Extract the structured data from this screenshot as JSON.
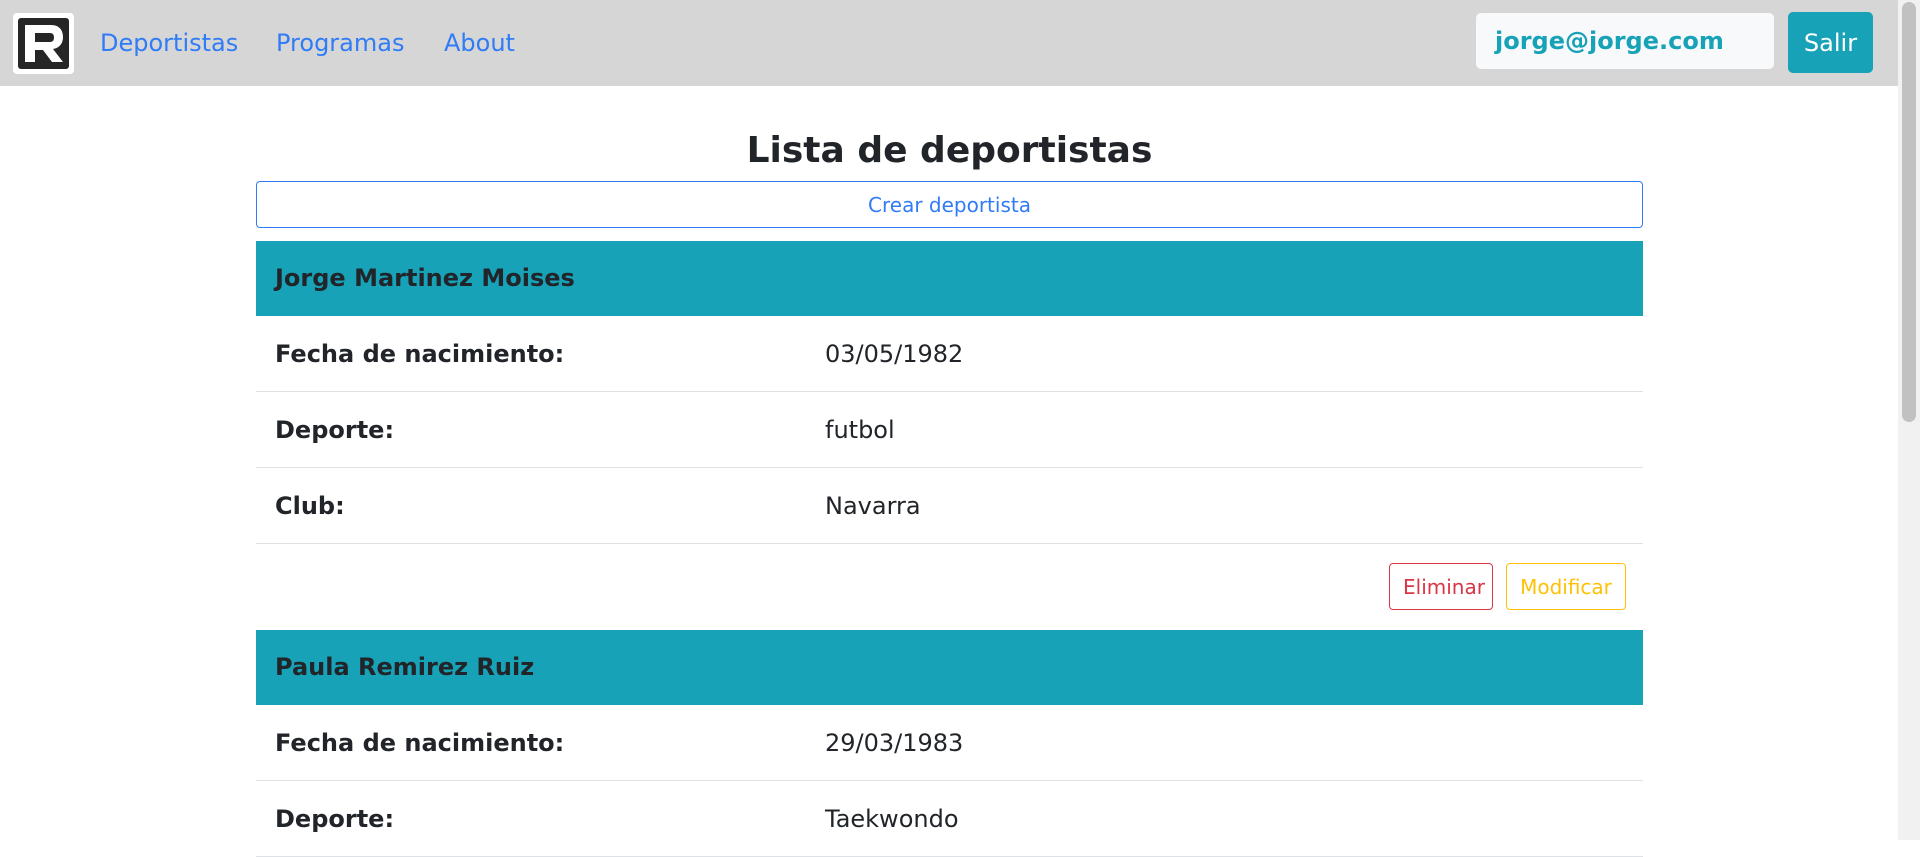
{
  "colors": {
    "primary": "#2f7cf6",
    "info": "#17a2b8",
    "danger": "#dc3545",
    "warning": "#ffc107",
    "navbar_bg": "#d6d6d6"
  },
  "navbar": {
    "logo_icon": "r-logo-icon",
    "links": [
      "Deportistas",
      "Programas",
      "About"
    ],
    "user_email": "jorge@jorge.com",
    "logout_label": "Salir"
  },
  "main": {
    "title": "Lista de deportistas",
    "create_label": "Crear deportista",
    "field_labels": {
      "birth": "Fecha de nacimiento:",
      "sport": "Deporte:",
      "club": "Club:"
    },
    "athletes": [
      {
        "name": "Jorge Martinez Moises",
        "birth": "03/05/1982",
        "sport": "futbol",
        "club": "Navarra",
        "delete_label": "Eliminar",
        "edit_label": "Modificar"
      },
      {
        "name": "Paula Remirez Ruiz",
        "birth": "29/03/1983",
        "sport": "Taekwondo"
      }
    ]
  }
}
